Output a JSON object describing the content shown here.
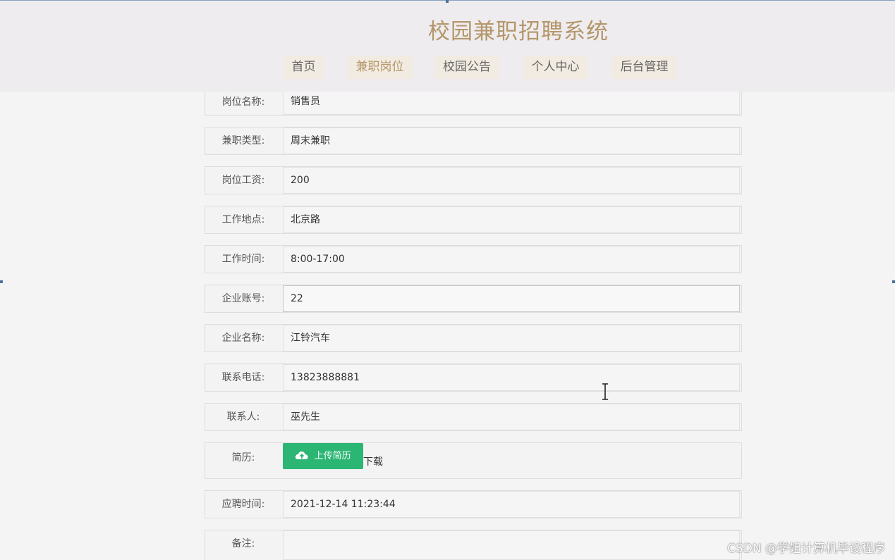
{
  "header": {
    "site_title": "校园兼职招聘系统",
    "nav": [
      {
        "label": "首页",
        "active": false
      },
      {
        "label": "兼职岗位",
        "active": true
      },
      {
        "label": "校园公告",
        "active": false
      },
      {
        "label": "个人中心",
        "active": false
      },
      {
        "label": "后台管理",
        "active": false
      }
    ]
  },
  "form": {
    "fields": [
      {
        "label": "岗位名称:",
        "value": "销售员"
      },
      {
        "label": "兼职类型:",
        "value": "周末兼职"
      },
      {
        "label": "岗位工资:",
        "value": "200"
      },
      {
        "label": "工作地点:",
        "value": "北京路"
      },
      {
        "label": "工作时间:",
        "value": "8:00-17:00"
      },
      {
        "label": "企业账号:",
        "value": "22"
      },
      {
        "label": "企业名称:",
        "value": "江铃汽车"
      },
      {
        "label": "联系电话:",
        "value": "13823888881"
      },
      {
        "label": "联系人:",
        "value": "巫先生"
      }
    ],
    "resume": {
      "label": "简历:",
      "upload_label": "上传简历",
      "download_label": "下载"
    },
    "apply_time": {
      "label": "应聘时间:",
      "value": "2021-12-14 11:23:44"
    },
    "remark": {
      "label": "备注:",
      "value": ""
    }
  },
  "watermark": "CSDN @学姐计算机毕设程序",
  "colors": {
    "accent": "#b4966a",
    "upload_button": "#2bb673",
    "header_bg": "#eeecee"
  },
  "icons": {
    "upload": "cloud-upload-icon",
    "cursor": "text-cursor-icon"
  }
}
